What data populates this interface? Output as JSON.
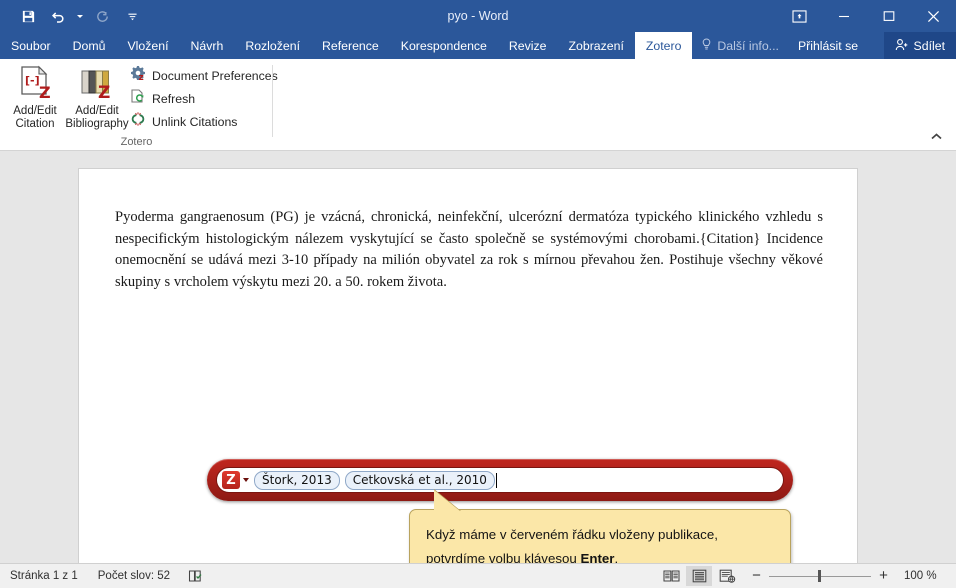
{
  "window": {
    "title": "pyo - Word",
    "quick_access": [
      {
        "name": "save",
        "label": "Uložit",
        "icon": "save-icon",
        "disabled": false
      },
      {
        "name": "undo",
        "label": "Zpět",
        "icon": "undo-icon",
        "disabled": false
      },
      {
        "name": "redo",
        "label": "Znovu",
        "icon": "redo-icon",
        "disabled": true
      },
      {
        "name": "customize-qat",
        "label": "Přizpůsobit panel nástrojů Rychlý přístup",
        "icon": "chevron-down-icon",
        "disabled": false
      }
    ],
    "controls": [
      {
        "name": "ribbon-display-options",
        "label": "Možnosti zobrazení pásu karet",
        "icon": "ribbon-options-icon"
      },
      {
        "name": "minimize",
        "label": "Minimalizovat",
        "icon": "minimize-icon"
      },
      {
        "name": "maximize",
        "label": "Maximalizovat",
        "icon": "maximize-icon"
      },
      {
        "name": "close",
        "label": "Zavřít",
        "icon": "close-icon"
      }
    ]
  },
  "ribbon": {
    "tabs": [
      {
        "label": "Soubor",
        "active": false
      },
      {
        "label": "Domů",
        "active": false
      },
      {
        "label": "Vložení",
        "active": false
      },
      {
        "label": "Návrh",
        "active": false
      },
      {
        "label": "Rozložení",
        "active": false
      },
      {
        "label": "Reference",
        "active": false
      },
      {
        "label": "Korespondence",
        "active": false
      },
      {
        "label": "Revize",
        "active": false
      },
      {
        "label": "Zobrazení",
        "active": false
      },
      {
        "label": "Zotero",
        "active": true
      }
    ],
    "tell_me": "Další info...",
    "sign_in": "Přihlásit se",
    "share": "Sdílet",
    "collapse_tooltip": "Sbalit pás karet",
    "group": {
      "label": "Zotero",
      "big_buttons": [
        {
          "label_line1": "Add/Edit",
          "label_line2": "Citation",
          "icon": "add-edit-citation-icon"
        },
        {
          "label_line1": "Add/Edit",
          "label_line2": "Bibliography",
          "icon": "add-edit-bibliography-icon"
        }
      ],
      "small_buttons": [
        {
          "label": "Document Preferences",
          "icon": "document-preferences-icon"
        },
        {
          "label": "Refresh",
          "icon": "refresh-icon"
        },
        {
          "label": "Unlink Citations",
          "icon": "unlink-citations-icon"
        }
      ]
    }
  },
  "document": {
    "paragraph": "Pyoderma gangraenosum (PG) je vzácná, chronická, neinfekční, ulcerózní dermatóza typického klinického vzhledu s nespecifickým histologickým nálezem vyskytující se často společně se systémovými chorobami.{Citation} Incidence onemocnění se udává mezi 3-10 případy na milión obyvatel za rok s mírnou převahou žen. Postihuje všechny věkové skupiny s vrcholem výskytu mezi 20. a 50. rokem života."
  },
  "citation_bar": {
    "logo_letter": "Z",
    "bubbles": [
      {
        "label": "Štork, 2013"
      },
      {
        "label": "Cetkovská et al., 2010"
      }
    ]
  },
  "callout": {
    "text_before": "Když máme v červeném řádku vloženy publikace, potvrdíme volbu klávesou ",
    "keyword": "Enter",
    "text_after": "."
  },
  "status_bar": {
    "page": "Stránka 1 z 1",
    "word_count": "Počet slov: 52",
    "proofing_icon": "proofing-book-icon",
    "view_modes": [
      {
        "name": "read-mode",
        "label": "Režim čtení",
        "icon": "read-mode-icon",
        "selected": false
      },
      {
        "name": "print-layout",
        "label": "Rozložení při tisku",
        "icon": "print-layout-icon",
        "selected": true
      },
      {
        "name": "web-layout",
        "label": "Rozložení webové stránky",
        "icon": "web-layout-icon",
        "selected": false
      }
    ],
    "zoom_out": "−",
    "zoom_in": "+",
    "zoom_percent": "100 %"
  },
  "colors": {
    "title_bar": "#2b579a",
    "share_bg": "#1f4788",
    "citation_bar_red": "#a8201a",
    "callout_yellow": "#fbe7a8",
    "callout_border": "#b9a35e",
    "zotero_red": "#cc2936",
    "app_chrome": "#e6e6e6"
  }
}
